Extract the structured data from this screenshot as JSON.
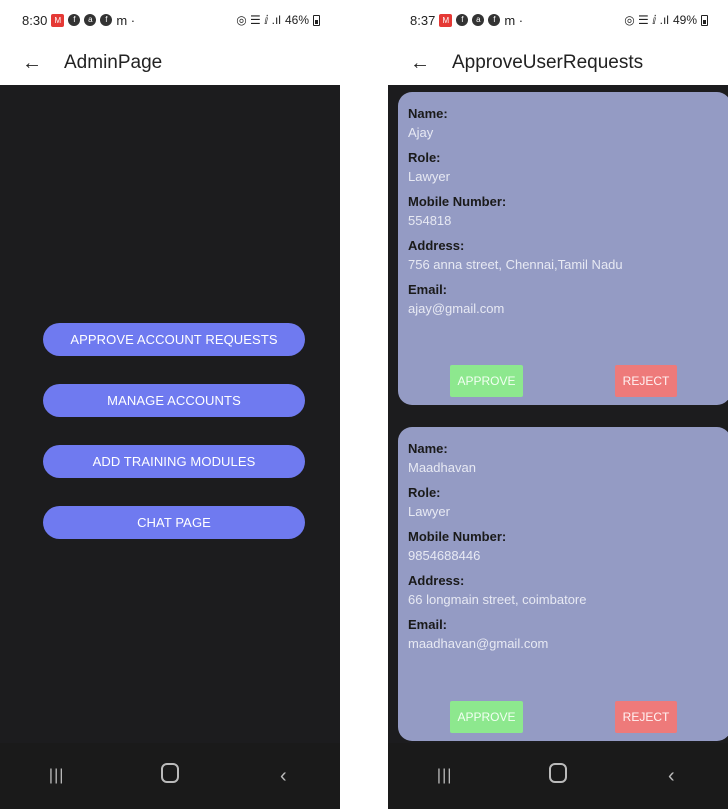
{
  "left_screen": {
    "status": {
      "time": "8:30",
      "battery": "46%",
      "glyphs": "m ·",
      "signal": "◎ ☰ ⅈ .ıl"
    },
    "title": "AdminPage",
    "buttons": [
      "APPROVE ACCOUNT REQUESTS",
      "MANAGE ACCOUNTS",
      "ADD TRAINING MODULES",
      "CHAT PAGE"
    ]
  },
  "right_screen": {
    "status": {
      "time": "8:37",
      "battery": "49%",
      "glyphs": "m ·",
      "signal": "◎ ☰ ⅈ .ıl"
    },
    "title": "ApproveUserRequests",
    "labels": {
      "name": "Name:",
      "role": "Role:",
      "mobile": "Mobile Number:",
      "address": "Address:",
      "email": "Email:"
    },
    "actions": {
      "approve": "APPROVE",
      "reject": "REJECT"
    },
    "requests": [
      {
        "name": "Ajay",
        "role": "Lawyer",
        "mobile": "554818",
        "address": "756 anna street, Chennai,Tamil Nadu",
        "email": "ajay@gmail.com"
      },
      {
        "name": "Maadhavan",
        "role": "Lawyer",
        "mobile": "9854688446",
        "address": "66 longmain street, coimbatore",
        "email": "maadhavan@gmail.com"
      }
    ]
  },
  "nav": {
    "recent": "|||",
    "back": "‹"
  },
  "icons": {
    "back": "arrow-left-icon",
    "home": "home-icon",
    "recent": "recent-apps-icon",
    "nav_back": "chevron-left-icon"
  },
  "colors": {
    "admin_button": "#6f7af0",
    "card": "#949bc4",
    "approve": "#8de88e",
    "reject": "#ee7a7a",
    "background": "#1c1c1e"
  }
}
